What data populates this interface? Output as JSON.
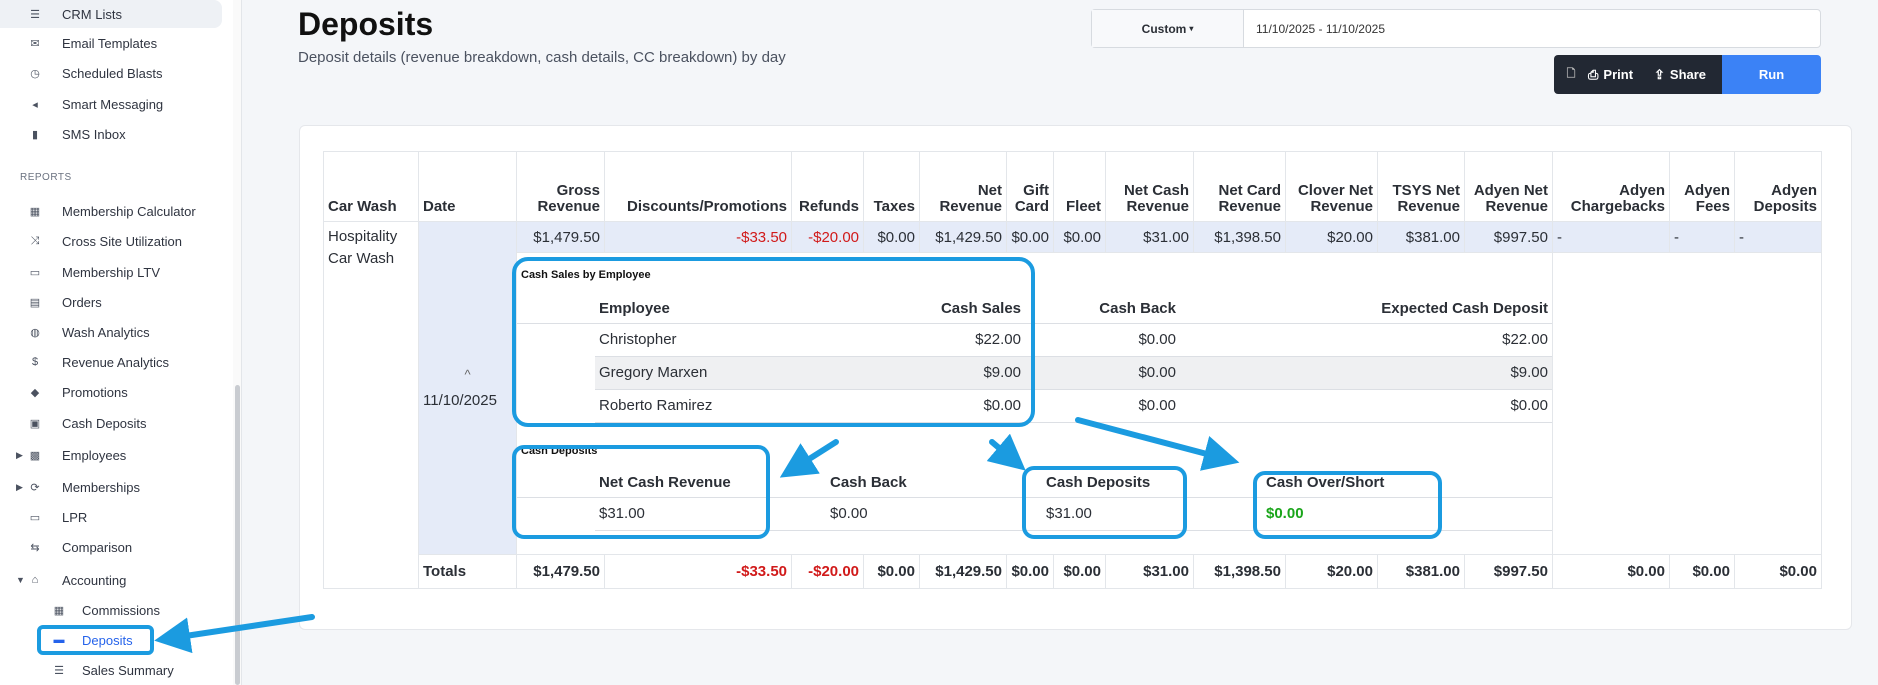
{
  "sidebar": {
    "top_items": [
      {
        "label": "CRM Lists",
        "icon": "list-icon"
      },
      {
        "label": "Email Templates",
        "icon": "envelope-icon"
      },
      {
        "label": "Scheduled Blasts",
        "icon": "clock-icon"
      },
      {
        "label": "Smart Messaging",
        "icon": "megaphone-icon"
      },
      {
        "label": "SMS Inbox",
        "icon": "phone-icon"
      }
    ],
    "section_label": "REPORTS",
    "report_items": [
      {
        "label": "Membership Calculator",
        "icon": "calculator-icon"
      },
      {
        "label": "Cross Site Utilization",
        "icon": "shuffle-icon"
      },
      {
        "label": "Membership LTV",
        "icon": "card-icon"
      },
      {
        "label": "Orders",
        "icon": "orders-icon"
      },
      {
        "label": "Wash Analytics",
        "icon": "droplet-icon"
      },
      {
        "label": "Revenue Analytics",
        "icon": "dollar-icon"
      },
      {
        "label": "Promotions",
        "icon": "tag-icon"
      },
      {
        "label": "Cash Deposits",
        "icon": "cash-icon"
      },
      {
        "label": "Employees",
        "icon": "users-icon"
      },
      {
        "label": "Memberships",
        "icon": "refresh-icon"
      },
      {
        "label": "LPR",
        "icon": "camera-icon"
      },
      {
        "label": "Comparison",
        "icon": "compare-icon"
      },
      {
        "label": "Accounting",
        "icon": "bank-icon"
      }
    ],
    "accounting_items": [
      {
        "label": "Commissions",
        "icon": "calculator-icon"
      },
      {
        "label": "Deposits",
        "icon": "money-icon"
      },
      {
        "label": "Sales Summary",
        "icon": "list-icon"
      }
    ]
  },
  "header": {
    "title": "Deposits",
    "subtitle": "Deposit details (revenue breakdown, cash details, CC breakdown) by day",
    "range_select": "Custom",
    "date_range": "11/10/2025 - 11/10/2025",
    "print_label": "Print",
    "share_label": "Share",
    "run_label": "Run"
  },
  "table": {
    "headers": [
      "Car Wash",
      "Date",
      "Gross Revenue",
      "Discounts/Promotions",
      "Refunds",
      "Taxes",
      "Net Revenue",
      "Gift Card",
      "Fleet",
      "Net Cash Revenue",
      "Net Card Revenue",
      "Clover Net Revenue",
      "TSYS Net Revenue",
      "Adyen Net Revenue",
      "Adyen Chargebacks",
      "Adyen Fees",
      "Adyen Deposits"
    ],
    "row": {
      "car_wash": "Hospitality Car Wash",
      "date": "11/10/2025",
      "values": [
        "$1,479.50",
        "-$33.50",
        "-$20.00",
        "$0.00",
        "$1,429.50",
        "$0.00",
        "$0.00",
        "$31.00",
        "$1,398.50",
        "$20.00",
        "$381.00",
        "$997.50",
        "-",
        "-",
        "-"
      ]
    },
    "totals_label": "Totals",
    "totals": [
      "$1,479.50",
      "-$33.50",
      "-$20.00",
      "$0.00",
      "$1,429.50",
      "$0.00",
      "$0.00",
      "$31.00",
      "$1,398.50",
      "$20.00",
      "$381.00",
      "$997.50",
      "$0.00",
      "$0.00",
      "$0.00"
    ]
  },
  "cash_sales": {
    "title": "Cash Sales by Employee",
    "headers": [
      "Employee",
      "Cash Sales",
      "Cash Back",
      "Expected Cash Deposit"
    ],
    "rows": [
      [
        "Christopher",
        "$22.00",
        "$0.00",
        "$22.00"
      ],
      [
        "Gregory Marxen",
        "$9.00",
        "$0.00",
        "$9.00"
      ],
      [
        "Roberto Ramirez",
        "$0.00",
        "$0.00",
        "$0.00"
      ]
    ]
  },
  "cash_deposits": {
    "title": "Cash Deposits",
    "headers": [
      "Net Cash Revenue",
      "Cash Back",
      "Cash Deposits",
      "Cash Over/Short"
    ],
    "values": [
      "$31.00",
      "$0.00",
      "$31.00",
      "$0.00"
    ]
  },
  "colors": {
    "accent": "#3b82f6",
    "annotation": "#1b9be0",
    "negative": "#d11a1a",
    "positive": "#1aa51a"
  }
}
